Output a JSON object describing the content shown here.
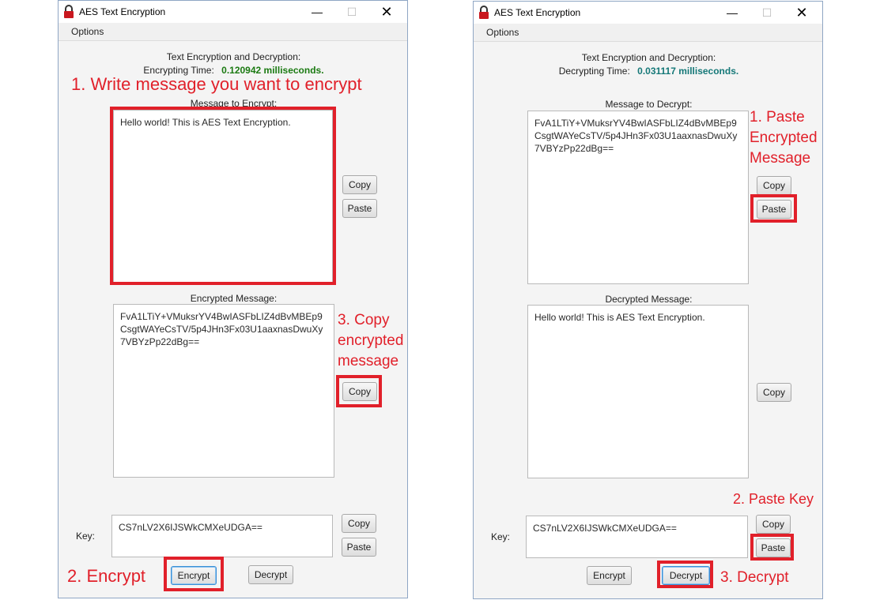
{
  "left_window": {
    "title": "AES Text Encryption",
    "menu": "Options",
    "header": "Text Encryption and Decryption:",
    "time_label": "Encrypting Time:",
    "time_value": "0.120942 milliseconds.",
    "input_label": "Message to Encrypt:",
    "input_text": "Hello world! This is AES Text Encryption.",
    "output_label": "Encrypted Message:",
    "output_text": "FvA1LTiY+VMuksrYV4BwIASFbLIZ4dBvMBEp9CsgtWAYeCsTV/5p4JHn3Fx03U1aaxnasDwuXy7VBYzPp22dBg==",
    "key_label": "Key:",
    "key_text": "CS7nLV2X6IJSWkCMXeUDGA==",
    "copy": "Copy",
    "paste": "Paste",
    "encrypt": "Encrypt",
    "decrypt": "Decrypt"
  },
  "right_window": {
    "title": "AES Text Encryption",
    "menu": "Options",
    "header": "Text Encryption and Decryption:",
    "time_label": "Decrypting Time:",
    "time_value": "0.031117 milliseconds.",
    "input_label": "Message to Decrypt:",
    "input_text": "FvA1LTiY+VMuksrYV4BwIASFbLIZ4dBvMBEp9CsgtWAYeCsTV/5p4JHn3Fx03U1aaxnasDwuXy7VBYzPp22dBg==",
    "output_label": "Decrypted Message:",
    "output_text": "Hello world! This is AES Text Encryption.",
    "key_label": "Key:",
    "key_text": "CS7nLV2X6IJSWkCMXeUDGA==",
    "copy": "Copy",
    "paste": "Paste",
    "encrypt": "Encrypt",
    "decrypt": "Decrypt"
  },
  "annotations": {
    "left_step1": "1. Write message you want to encrypt",
    "left_step2": "2. Encrypt",
    "left_step3_line1": "3. Copy",
    "left_step3_line2": "encrypted",
    "left_step3_line3": "message",
    "right_step1_line1": "1. Paste",
    "right_step1_line2": "Encrypted",
    "right_step1_line3": "Message",
    "right_step2": "2. Paste Key",
    "right_step3": "3. Decrypt"
  },
  "colors": {
    "highlight": "#e1202a",
    "encrypt_time": "#1b7a12",
    "decrypt_time": "#157878"
  },
  "icons": {
    "app": "padlock-icon"
  }
}
